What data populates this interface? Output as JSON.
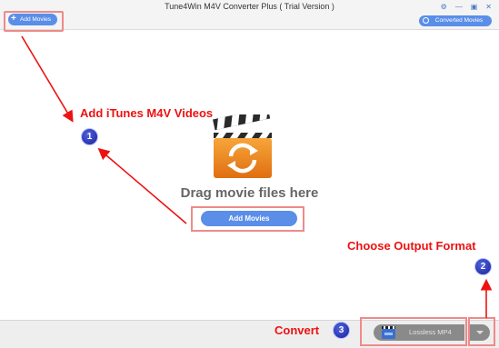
{
  "window": {
    "title": "Tune4Win M4V Converter Plus ( Trial Version )"
  },
  "toolbar": {
    "add_movies_label": "Add Movies",
    "add_icon": "plus-icon",
    "converted_movies_label": "Converted Movies",
    "converted_icon": "clock-icon"
  },
  "window_controls": {
    "settings_icon": "gear-icon",
    "minimize_icon": "minimize-icon",
    "maximize_icon": "maximize-icon",
    "close_icon": "close-icon"
  },
  "main": {
    "drag_text": "Drag movie files here",
    "add_movies_label": "Add Movies",
    "center_icon": "clapperboard-convert-icon"
  },
  "bottom": {
    "format_label": "Lossless MP4",
    "format_icon": "mp4-icon",
    "dropdown_icon": "chevron-down-icon"
  },
  "annotations": {
    "step1_text": "Add iTunes M4V Videos",
    "step1_num": "1",
    "step2_text": "Choose Output Format",
    "step2_num": "2",
    "step3_text": "Convert",
    "step3_num": "3"
  },
  "colors": {
    "accent": "#5a8ee8",
    "annotation": "#ee1111",
    "highlight": "#ef8a8a"
  }
}
